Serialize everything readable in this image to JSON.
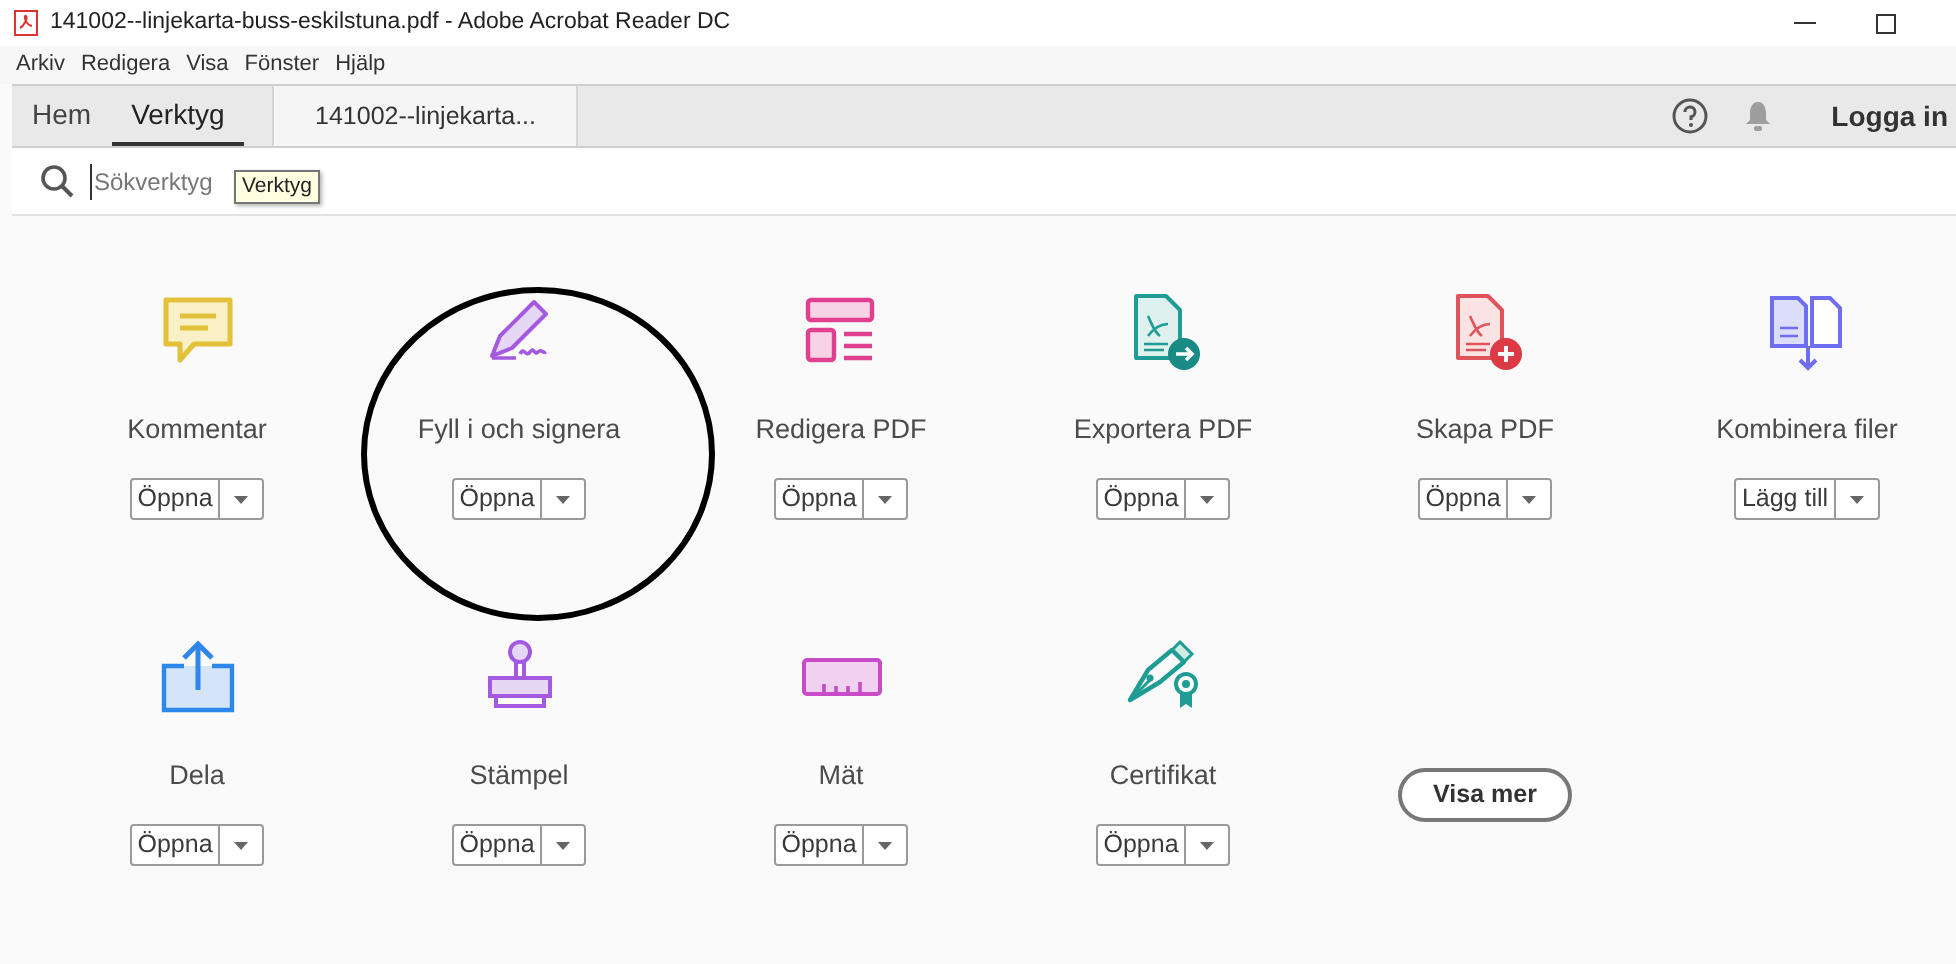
{
  "window": {
    "title": "141002--linjekarta-buss-eskilstuna.pdf - Adobe Acrobat Reader DC"
  },
  "menu": [
    "Arkiv",
    "Redigera",
    "Visa",
    "Fönster",
    "Hjälp"
  ],
  "tabs": [
    {
      "label": "Hem",
      "selected": false
    },
    {
      "label": "Verktyg",
      "selected": true
    }
  ],
  "document_tab": "141002--linjekarta...",
  "sign_in": "Logga in",
  "search": {
    "placeholder": "Sökverktyg"
  },
  "tooltip": "Verktyg",
  "tools": [
    {
      "kind": "comment",
      "name": "Kommentar",
      "action": "Öppna"
    },
    {
      "kind": "sign",
      "name": "Fyll i och signera",
      "action": "Öppna"
    },
    {
      "kind": "edit",
      "name": "Redigera PDF",
      "action": "Öppna"
    },
    {
      "kind": "export",
      "name": "Exportera PDF",
      "action": "Öppna"
    },
    {
      "kind": "create",
      "name": "Skapa PDF",
      "action": "Öppna"
    },
    {
      "kind": "combine",
      "name": "Kombinera filer",
      "action": "Lägg till"
    },
    {
      "kind": "share",
      "name": "Dela",
      "action": "Öppna"
    },
    {
      "kind": "stamp",
      "name": "Stämpel",
      "action": "Öppna"
    },
    {
      "kind": "measure",
      "name": "Mät",
      "action": "Öppna"
    },
    {
      "kind": "certificate",
      "name": "Certifikat",
      "action": "Öppna"
    }
  ],
  "more_button": "Visa mer"
}
